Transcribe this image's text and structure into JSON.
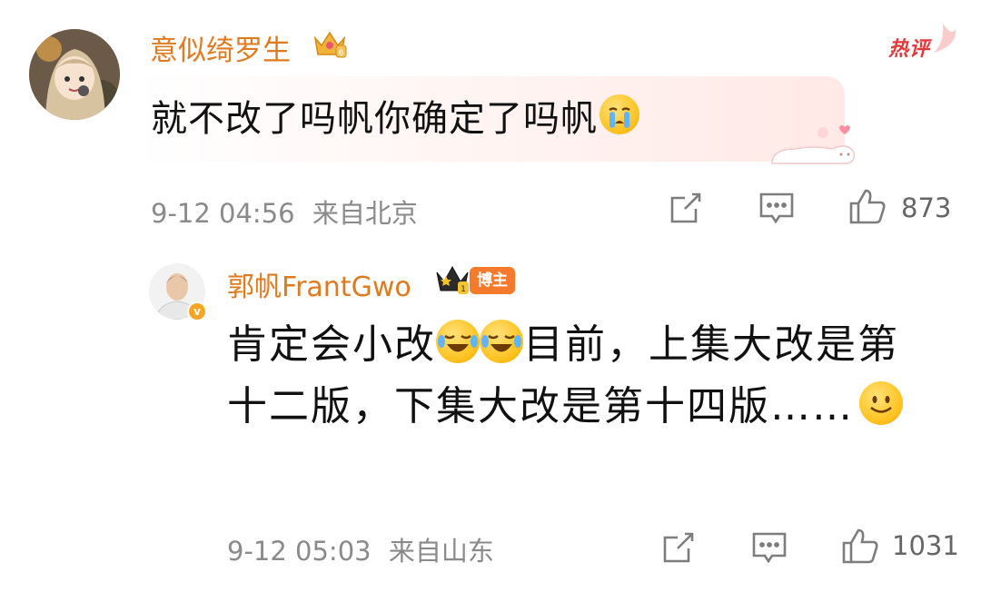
{
  "comments": [
    {
      "username": "意似绮罗生",
      "hot_label": "热评",
      "text": "就不改了吗帆你确定了吗帆",
      "time": "9-12 04:56",
      "location": "来自北京",
      "likes": "873"
    },
    {
      "username": "郭帆FrantGwo",
      "badge": "博主",
      "text_parts": [
        "肯定会小改",
        "目前，上集大改是第十二版，下集大改是第十四版……"
      ],
      "time": "9-12 05:03",
      "location": "来自山东",
      "likes": "1031"
    }
  ],
  "colors": {
    "username": "#e07a1f",
    "hot": "#e4393c",
    "badge": "#f57a2c",
    "meta": "#8a8a8a"
  },
  "icons": [
    "crown-icon",
    "share-icon",
    "comment-icon",
    "like-icon",
    "crying-emoji",
    "laugh-cry-emoji",
    "smile-emoji",
    "verified-badge-icon"
  ]
}
